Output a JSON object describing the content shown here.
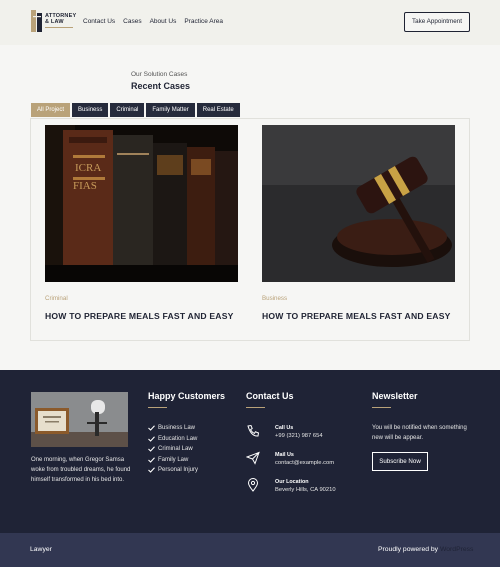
{
  "header": {
    "logo_line1": "ATTORNEY",
    "logo_line2": "& LAW",
    "nav": [
      "Contact Us",
      "Cases",
      "About Us",
      "Practice Area"
    ],
    "cta": "Take Appointment"
  },
  "cases": {
    "subtitle": "Our Solution Cases",
    "title": "Recent Cases",
    "tabs": [
      "All Project",
      "Business",
      "Criminal",
      "Family Matter",
      "Real Estate"
    ],
    "active_tab": "All Project",
    "items": [
      {
        "category": "Criminal",
        "title": "HOW TO PREPARE MEALS FAST AND EASY"
      },
      {
        "category": "Business",
        "title": "HOW TO PREPARE MEALS FAST AND EASY"
      }
    ]
  },
  "footer": {
    "about": "One morning, when Gregor Samsa woke from troubled dreams, he found himself transformed in his bed into.",
    "customers_title": "Happy Customers",
    "customers": [
      "Business Law",
      "Education Law",
      "Criminal Law",
      "Family Law",
      "Personal Injury"
    ],
    "contact_title": "Contact Us",
    "contacts": [
      {
        "label": "Call Us",
        "value": "+99 (321) 987 654",
        "icon": "phone-icon"
      },
      {
        "label": "Mail Us",
        "value": "contact@example.com",
        "icon": "paper-plane-icon"
      },
      {
        "label": "Our Location",
        "value": "Beverly Hills, CA 90210",
        "icon": "map-pin-icon"
      }
    ],
    "newsletter_title": "Newsletter",
    "newsletter_text": "You will be notified when something new will be appear.",
    "subscribe": "Subscribe Now"
  },
  "bottom": {
    "left": "Lawyer",
    "powered": "Proudly powered by ",
    "wp": "WordPress"
  },
  "colors": {
    "accent": "#b9a279",
    "navy": "#1f2336",
    "bottom_bar": "#323752"
  }
}
